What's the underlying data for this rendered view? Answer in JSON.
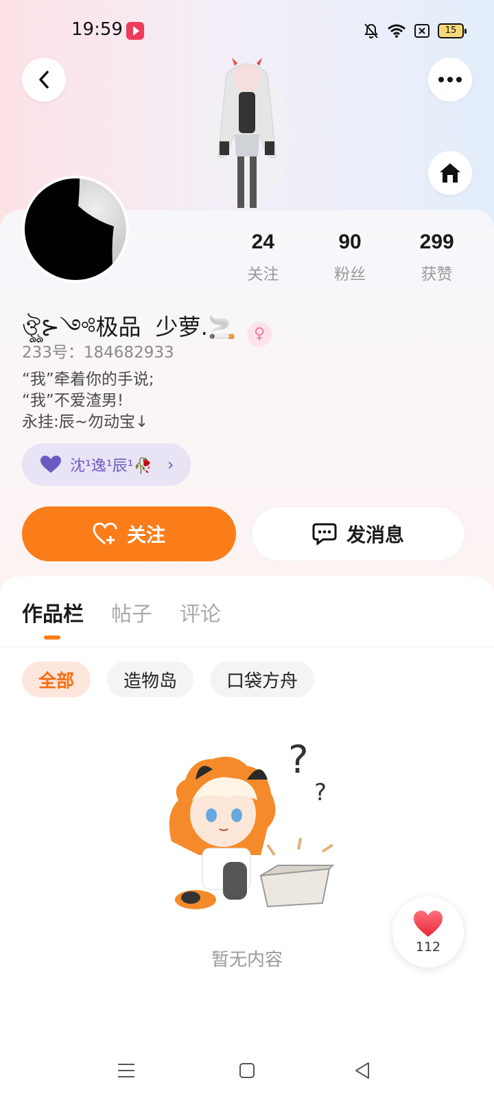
{
  "status_bar": {
    "time": "19:59",
    "battery": "15",
    "icons": [
      "app-notification-icon",
      "mute-bell-icon",
      "wifi-icon",
      "sim-icon",
      "battery-icon"
    ]
  },
  "header": {
    "back_icon": "chevron-left-icon",
    "more_icon": "more-dots-icon",
    "home_icon": "home-icon"
  },
  "profile": {
    "stats": [
      {
        "value": "24",
        "label": "关注"
      },
      {
        "value": "90",
        "label": "粉丝"
      },
      {
        "value": "299",
        "label": "获赞"
      }
    ],
    "username": "ঔৣ⊱༺极品  少萝.🚬",
    "gender_symbol": "♀",
    "user_id": "233号：184682933",
    "bio_lines": [
      "“我”牵着你的手说;",
      "“我”不爱渣男!",
      "永挂:辰~勿动宝↓"
    ],
    "cp_chip_label": "沈¹逸¹辰¹🥀"
  },
  "actions": {
    "follow_label": "关注",
    "message_label": "发消息"
  },
  "tabs": [
    {
      "label": "作品栏",
      "active": true
    },
    {
      "label": "帖子",
      "active": false
    },
    {
      "label": "评论",
      "active": false
    }
  ],
  "filters": [
    {
      "label": "全部",
      "active": true
    },
    {
      "label": "造物岛",
      "active": false
    },
    {
      "label": "口袋方舟",
      "active": false
    }
  ],
  "empty_state": {
    "text": "暂无内容"
  },
  "like_fab": {
    "count": "112"
  },
  "colors": {
    "accent": "#fb7d1a",
    "cp_chip_bg": "#e8e3f5",
    "cp_text": "#6a5bc3"
  }
}
